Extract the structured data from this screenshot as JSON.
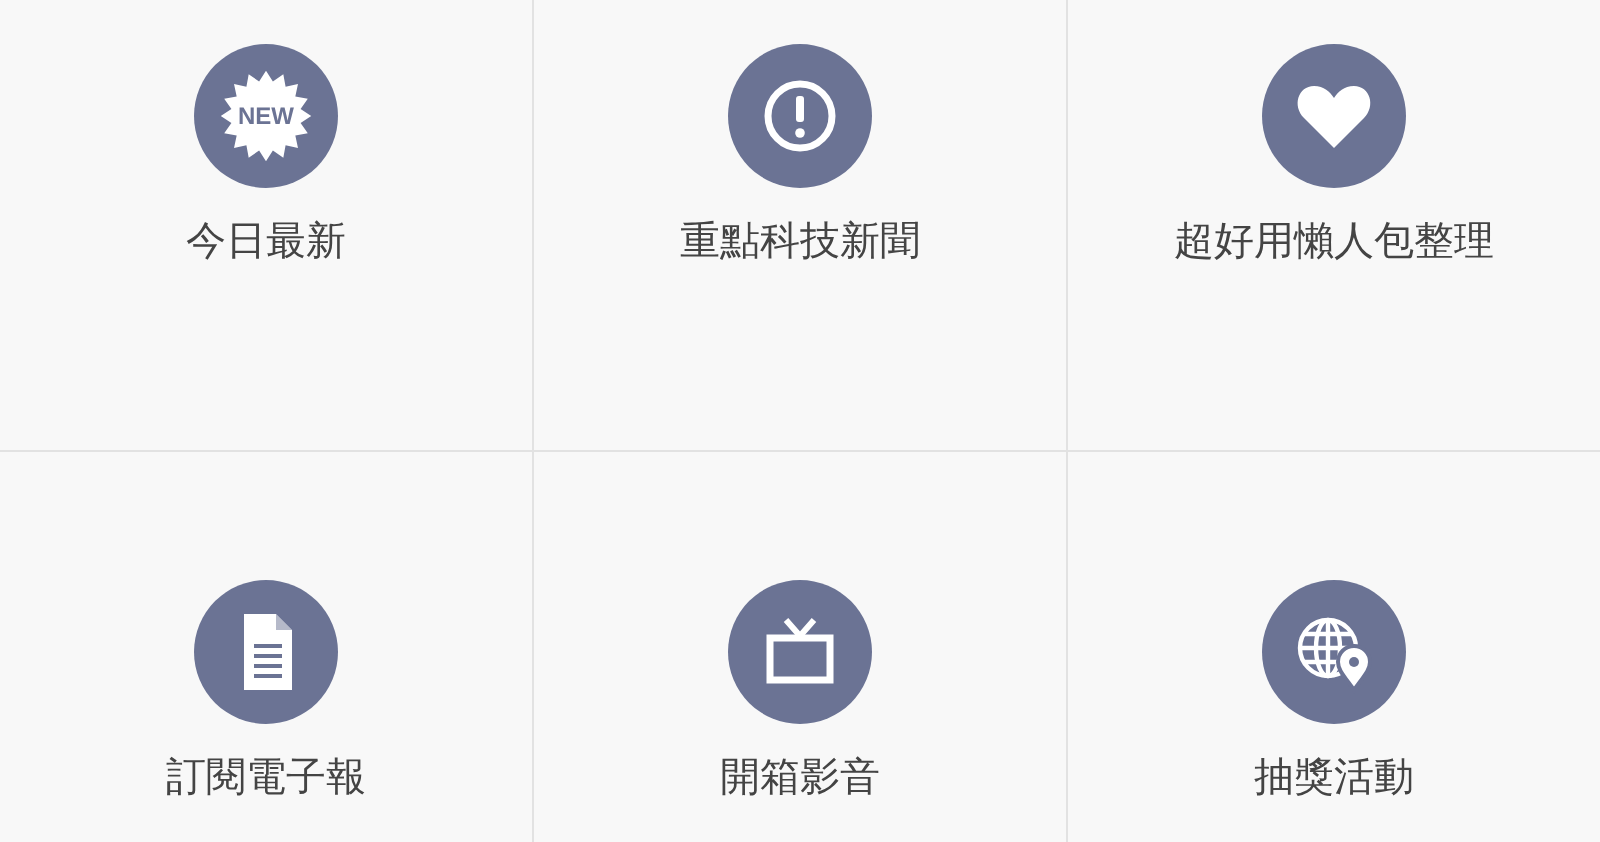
{
  "tiles": [
    {
      "kind": "new",
      "icon_text": "NEW",
      "label": "今日最新"
    },
    {
      "kind": "alert",
      "label": "重點科技新聞"
    },
    {
      "kind": "heart",
      "label": "超好用懶人包整理"
    },
    {
      "kind": "document",
      "label": "訂閱電子報"
    },
    {
      "kind": "tv",
      "label": "開箱影音"
    },
    {
      "kind": "globe",
      "label": "抽獎活動"
    }
  ]
}
